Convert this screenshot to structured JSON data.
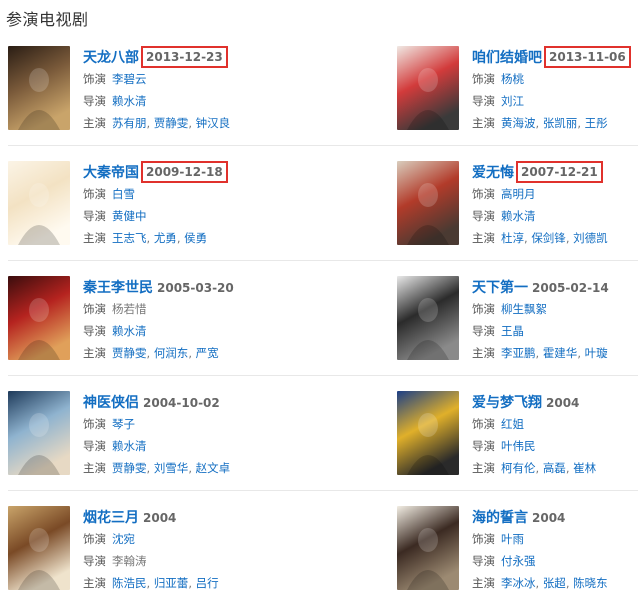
{
  "section_title": "参演电视剧",
  "labels": {
    "role": "饰演",
    "director": "导演",
    "stars": "主演"
  },
  "dramas": [
    {
      "title": "天龙八部",
      "year": "2013-12-23",
      "highlighted": true,
      "role": "李碧云",
      "role_linked": true,
      "director": "赖水清",
      "director_linked": true,
      "stars": [
        "苏有朋",
        "贾静雯",
        "钟汉良"
      ],
      "poster_colors": [
        "#2a1d14",
        "#7a5a3a",
        "#c9a46a"
      ]
    },
    {
      "title": "咱们结婚吧",
      "year": "2013-11-06",
      "highlighted": true,
      "role": "杨桃",
      "role_linked": true,
      "director": "刘江",
      "director_linked": true,
      "stars": [
        "黄海波",
        "张凯丽",
        "王彤"
      ],
      "poster_colors": [
        "#f0e9e4",
        "#d23b3b",
        "#3a3a3a"
      ]
    },
    {
      "title": "大秦帝国",
      "year": "2009-12-18",
      "highlighted": true,
      "role": "白雪",
      "role_linked": true,
      "director": "黄健中",
      "director_linked": true,
      "stars": [
        "王志飞",
        "尤勇",
        "侯勇"
      ],
      "poster_colors": [
        "#fbf4e6",
        "#f3e2c3",
        "#fffaf0"
      ]
    },
    {
      "title": "爱无悔",
      "year": "2007-12-21",
      "highlighted": true,
      "role": "高明月",
      "role_linked": true,
      "director": "赖水清",
      "director_linked": true,
      "stars": [
        "杜淳",
        "保剑锋",
        "刘德凯"
      ],
      "poster_colors": [
        "#d9cdbd",
        "#b23b2a",
        "#4a3a32"
      ]
    },
    {
      "title": "秦王李世民",
      "year": "2005-03-20",
      "highlighted": false,
      "role": "杨若惜",
      "role_linked": false,
      "director": "赖水清",
      "director_linked": true,
      "stars": [
        "贾静雯",
        "何润东",
        "严宽"
      ],
      "poster_colors": [
        "#3a0d0d",
        "#b5231f",
        "#e0a05a"
      ]
    },
    {
      "title": "天下第一",
      "year": "2005-02-14",
      "highlighted": false,
      "role": "柳生飘絮",
      "role_linked": true,
      "director": "王晶",
      "director_linked": true,
      "stars": [
        "李亚鹏",
        "霍建华",
        "叶璇"
      ],
      "poster_colors": [
        "#e9e9e9",
        "#2b2b2b",
        "#8a8a8a"
      ]
    },
    {
      "title": "神医侠侣",
      "year": "2004-10-02",
      "highlighted": false,
      "role": "琴子",
      "role_linked": true,
      "director": "赖水清",
      "director_linked": true,
      "stars": [
        "贾静雯",
        "刘雪华",
        "赵文卓"
      ],
      "poster_colors": [
        "#1e3a5a",
        "#8fb3cf",
        "#e7d9c4"
      ]
    },
    {
      "title": "爱与梦飞翔",
      "year": "2004",
      "highlighted": false,
      "role": "红姐",
      "role_linked": true,
      "director": "叶伟民",
      "director_linked": true,
      "stars": [
        "柯有伦",
        "高磊",
        "崔林"
      ],
      "poster_colors": [
        "#1c3f86",
        "#e0b02a",
        "#2a2a2a"
      ]
    },
    {
      "title": "烟花三月",
      "year": "2004",
      "highlighted": false,
      "role": "沈宛",
      "role_linked": true,
      "director": "李翰涛",
      "director_linked": false,
      "stars": [
        "陈浩民",
        "归亚蕾",
        "吕行"
      ],
      "poster_colors": [
        "#c9a46a",
        "#7a4a26",
        "#efe3cc"
      ]
    },
    {
      "title": "海的誓言",
      "year": "2004",
      "highlighted": false,
      "role": "叶雨",
      "role_linked": true,
      "director": "付永强",
      "director_linked": true,
      "stars": [
        "李冰冰",
        "张超",
        "陈晓东"
      ],
      "poster_colors": [
        "#f2ede3",
        "#3b2a22",
        "#9c8a72"
      ]
    }
  ]
}
